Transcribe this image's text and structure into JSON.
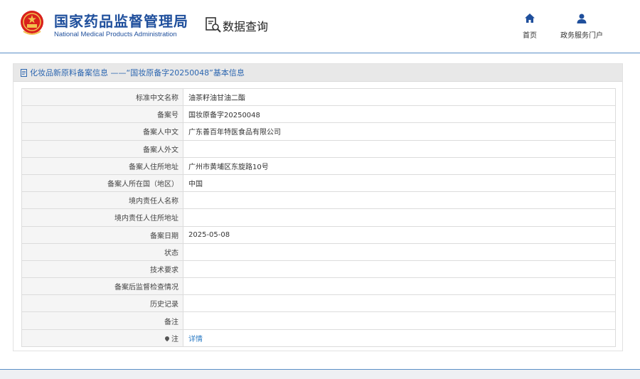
{
  "header": {
    "org_name_cn": "国家药品监督管理局",
    "org_name_en": "National Medical Products Administration",
    "section_title": "数据查询",
    "nav": [
      {
        "label": "首页",
        "icon": "home-icon"
      },
      {
        "label": "政务服务门户",
        "icon": "user-icon"
      }
    ]
  },
  "panel": {
    "title": "化妆品新原料备案信息 ——“国妆原备字20250048”基本信息"
  },
  "rows": [
    {
      "label": "标准中文名称",
      "value": "油茶籽油甘油二酯"
    },
    {
      "label": "备案号",
      "value": "国妆原备字20250048"
    },
    {
      "label": "备案人中文",
      "value": "广东善百年特医食品有限公司"
    },
    {
      "label": "备案人外文",
      "value": ""
    },
    {
      "label": "备案人住所地址",
      "value": "广州市黄埔区东旋路10号"
    },
    {
      "label": "备案人所在国（地区）",
      "value": "中国"
    },
    {
      "label": "境内责任人名称",
      "value": ""
    },
    {
      "label": "境内责任人住所地址",
      "value": ""
    },
    {
      "label": "备案日期",
      "value": "2025-05-08"
    },
    {
      "label": "状态",
      "value": ""
    },
    {
      "label": "技术要求",
      "value": ""
    },
    {
      "label": "备案后监督检查情况",
      "value": ""
    },
    {
      "label": "历史记录",
      "value": ""
    },
    {
      "label": "备注",
      "value": ""
    }
  ],
  "note_row": {
    "label": "注",
    "link_text": "详情"
  },
  "colors": {
    "brand": "#1f4f9c",
    "link": "#2c7bc4",
    "emblem": "#d9211c"
  }
}
